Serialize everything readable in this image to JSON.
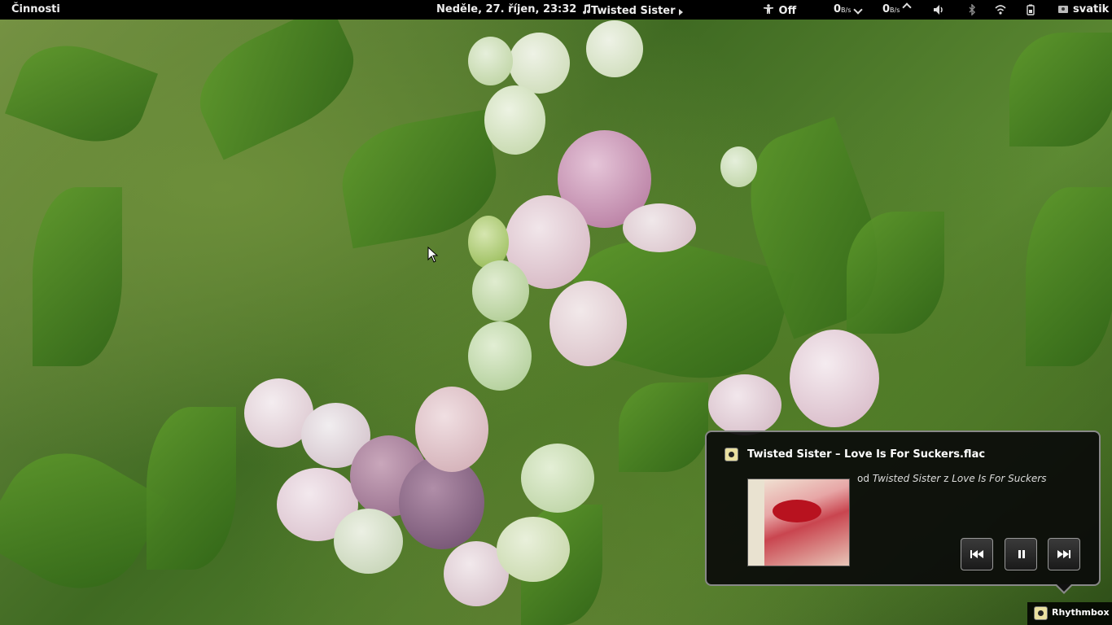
{
  "panel": {
    "activities": "Činnosti",
    "datetime": "Neděle, 27. říjen, 23:32",
    "music": "Twisted Sister",
    "accessibility_status": "Off",
    "net_down_value": "0",
    "net_down_unit": "B/s",
    "net_up_value": "0",
    "net_up_unit": "B/s",
    "user": "svatik"
  },
  "notification": {
    "title": "Twisted Sister – Love Is For Suckers.flac",
    "by_prefix": "od ",
    "artist": "Twisted Sister",
    "from_word": " z ",
    "album": "Love Is For Suckers"
  },
  "tray": {
    "app_name": "Rhythmbox"
  },
  "icons": {
    "music": "music-note-icon",
    "accessibility": "accessibility-icon",
    "volume": "volume-icon",
    "bluetooth": "bluetooth-icon",
    "wifi": "wifi-icon",
    "battery": "battery-icon",
    "user": "user-icon",
    "prev": "skip-previous-icon",
    "pause": "pause-icon",
    "next": "skip-next-icon"
  }
}
